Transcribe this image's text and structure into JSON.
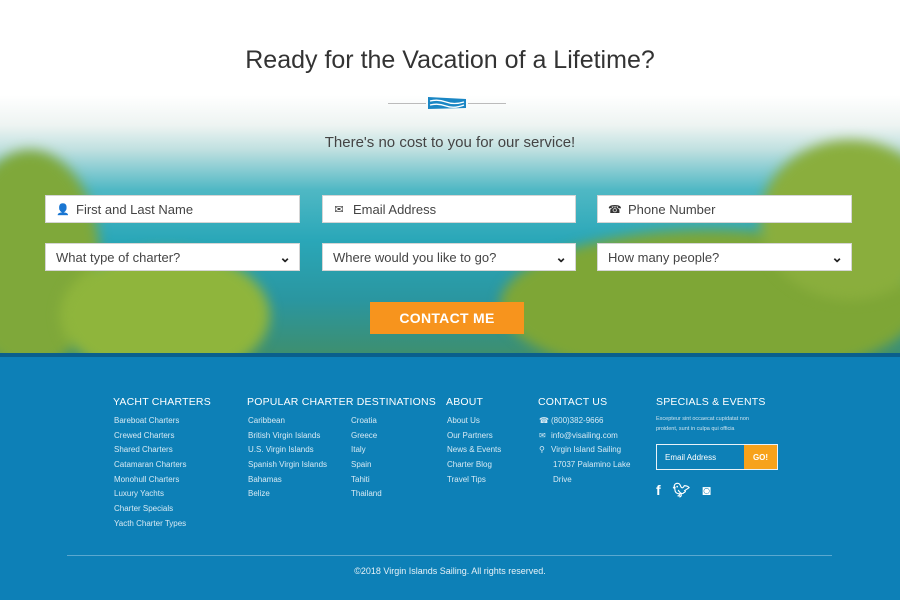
{
  "hero": {
    "title": "Ready for the Vacation of a Lifetime?",
    "subtitle": "There's no cost to you for our service!",
    "fields": {
      "name": "First and Last Name",
      "email": "Email Address",
      "phone": "Phone Number"
    },
    "selects": {
      "charter": "What type of charter?",
      "destination": "Where would you like to go?",
      "people": "How many people?"
    },
    "cta": "CONTACT ME"
  },
  "footer": {
    "yacht": {
      "title": "YACHT CHARTERS",
      "items": [
        "Bareboat Charters",
        "Crewed Charters",
        "Shared Charters",
        "Catamaran Charters",
        "Monohull Charters",
        "Luxury Yachts",
        "Charter Specials",
        "Yacth Charter Types"
      ]
    },
    "destinations": {
      "title": "POPULAR CHARTER DESTINATIONS",
      "col1": [
        "Caribbean",
        "British Virgin Islands",
        "U.S. Virgin Islands",
        "Spanish Virgin Islands",
        "Bahamas",
        "Belize"
      ],
      "col2": [
        "Croatia",
        "Greece",
        "Italy",
        "Spain",
        "Tahiti",
        "Thailand"
      ]
    },
    "about": {
      "title": "ABOUT",
      "items": [
        "About Us",
        "Our Partners",
        "News & Events",
        "Charter Blog",
        "Travel Tips"
      ]
    },
    "contact": {
      "title": "CONTACT US",
      "phone": "(800)382-9666",
      "email": "info@visailing.com",
      "address1": "Virgin Island Sailing",
      "address2": "17037 Palamino Lake",
      "address3": "Drive"
    },
    "specials": {
      "title": "SPECIALS & EVENTS",
      "text": "Excepteur sint occaecat cupidatat non proident, sunt in culpa qui officia",
      "email_placeholder": "Email Address",
      "go": "GO!"
    },
    "copyright": "©2018 Virgin Islands Sailing. All rights reserved."
  },
  "colors": {
    "accent": "#f7941d",
    "footer": "#0d80b7"
  }
}
